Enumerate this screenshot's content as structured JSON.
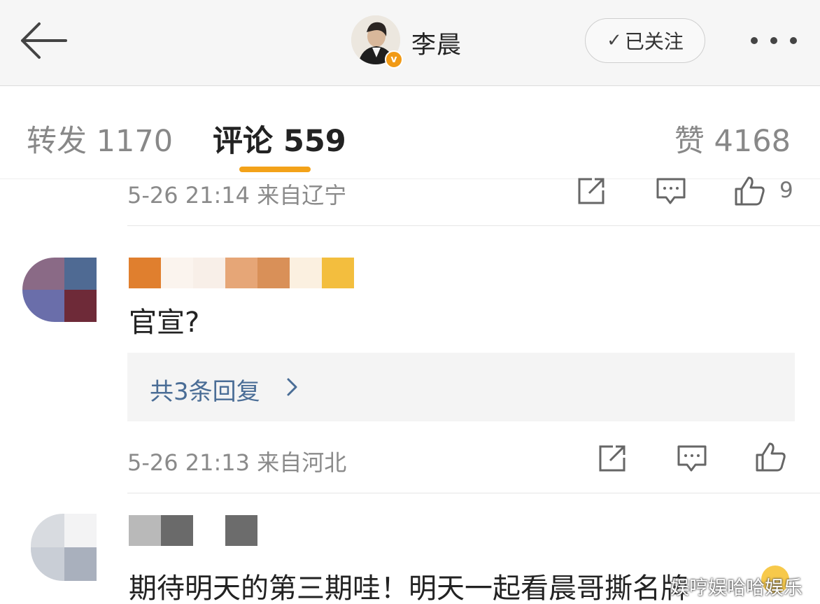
{
  "header": {
    "username": "李晨",
    "follow_label": "已关注",
    "follow_check": "✓",
    "verified_mark": "v"
  },
  "tabs": [
    {
      "label": "转发 1170"
    },
    {
      "label": "评论 559"
    },
    {
      "label": "赞 4168"
    }
  ],
  "comments": [
    {
      "meta": "5-26 21:14  来自辽宁",
      "like_count": "9"
    },
    {
      "text": "官宣?",
      "reply_link": "共3条回复",
      "meta": "5-26 21:13  来自河北"
    },
    {
      "text": "期待明天的第三期哇！明天一起看晨哥撕名牌"
    }
  ],
  "icons": {
    "back": "back-arrow-icon",
    "more": "more-dots-icon",
    "share": "share-icon",
    "comment": "comment-icon",
    "like": "thumbs-up-icon",
    "chevron": "chevron-right-icon"
  },
  "watermark": "娱哼娱哈哈娱乐",
  "colors": {
    "accent": "#f3a219",
    "link": "#4a6d96",
    "badge": "#f19a16"
  }
}
